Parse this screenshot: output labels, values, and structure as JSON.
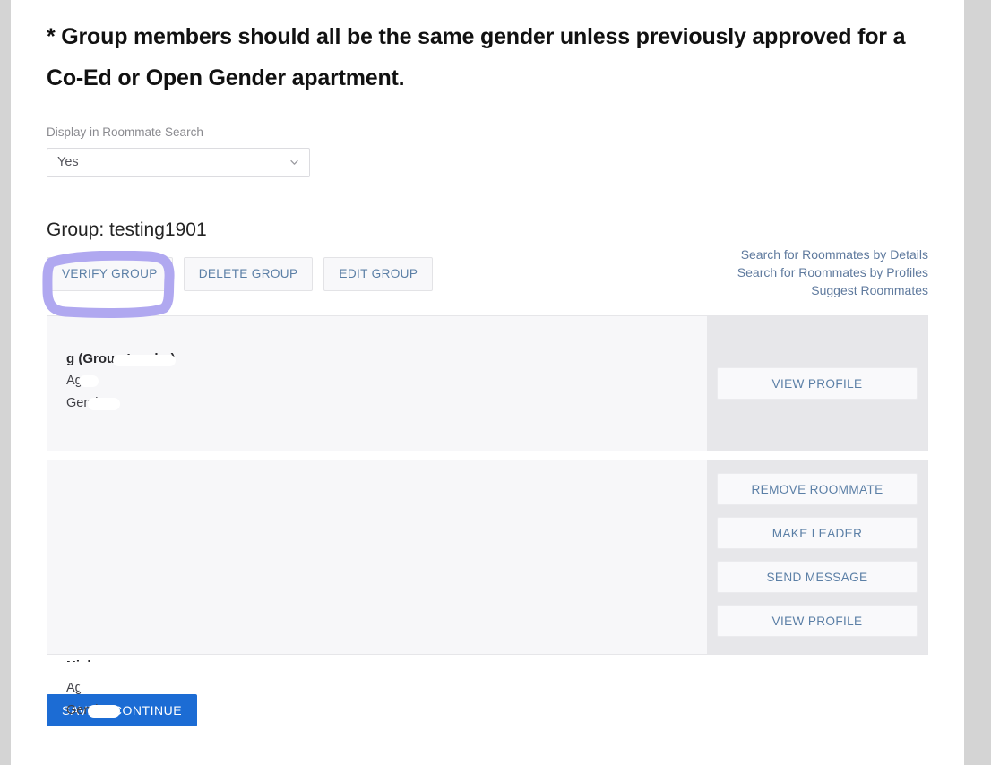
{
  "notice": "* Group members should all be the same gender unless previously approved for a Co-Ed or Open Gender apartment.",
  "display_field": {
    "label": "Display in Roommate Search",
    "value": "Yes",
    "chevron_icon": "chevron-down-icon"
  },
  "group": {
    "title": "Group: testing1901",
    "buttons": [
      {
        "label": "VERIFY GROUP",
        "name": "verify-group-button"
      },
      {
        "label": "DELETE GROUP",
        "name": "delete-group-button"
      },
      {
        "label": "EDIT GROUP",
        "name": "edit-group-button"
      }
    ],
    "links": [
      {
        "label": "Search for Roommates by Details",
        "name": "search-roommates-by-details-link"
      },
      {
        "label": "Search for Roommates by Profiles",
        "name": "search-roommates-by-profiles-link"
      },
      {
        "label": "Suggest Roommates",
        "name": "suggest-roommates-link"
      }
    ]
  },
  "members": [
    {
      "name_suffix": "g (Group Leader)",
      "age_label": "Age:",
      "gender_label": "Gender:",
      "buttons": [
        {
          "label": "VIEW PROFILE",
          "name": "view-profile-button"
        }
      ]
    },
    {
      "name_prefix": "Nick",
      "age_label": "Age:",
      "gender_label": "Gender:",
      "buttons": [
        {
          "label": "REMOVE ROOMMATE",
          "name": "remove-roommate-button"
        },
        {
          "label": "MAKE LEADER",
          "name": "make-leader-button"
        },
        {
          "label": "SEND MESSAGE",
          "name": "send-message-button"
        },
        {
          "label": "VIEW PROFILE",
          "name": "view-profile-button"
        }
      ]
    }
  ],
  "save": {
    "label": "SAVE & CONTINUE"
  },
  "colors": {
    "primary_button": "#1c6cd4",
    "link": "#5f7a9e",
    "annotation": "#b0a8f0",
    "card_background": "#f7f7f9",
    "card_side_background": "#e7e7ea"
  },
  "annotation": {
    "target": "verify-group-button",
    "shape": "hand-drawn-rectangle",
    "color": "#b0a8f0"
  }
}
